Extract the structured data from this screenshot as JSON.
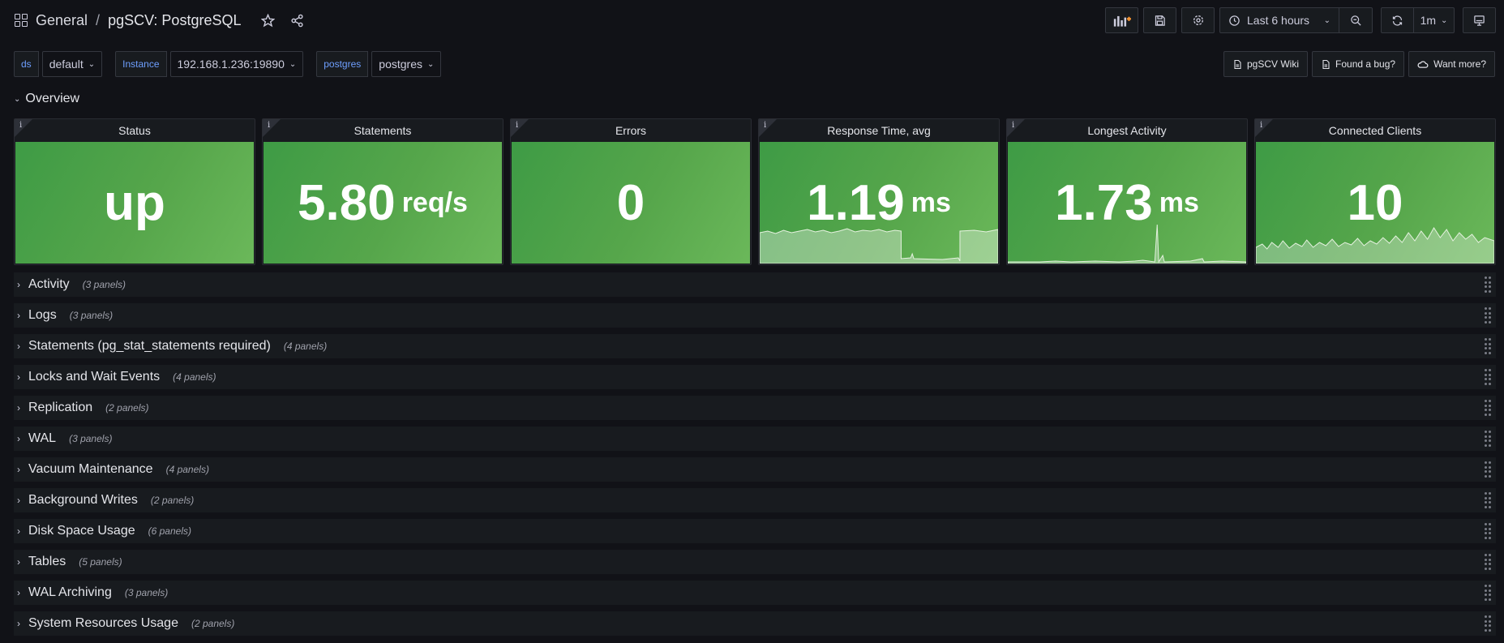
{
  "nav": {
    "breadcrumb_root": "General",
    "separator": "/",
    "dashboard_title": "pgSCV: PostgreSQL",
    "time_range": "Last 6 hours",
    "refresh_interval": "1m"
  },
  "variables": [
    {
      "label": "ds",
      "value": "default"
    },
    {
      "label": "Instance",
      "value": "192.168.1.236:19890"
    },
    {
      "label": "postgres",
      "value": "postgres"
    }
  ],
  "links": [
    {
      "label": "pgSCV Wiki",
      "icon": "doc-icon"
    },
    {
      "label": "Found a bug?",
      "icon": "doc-icon"
    },
    {
      "label": "Want more?",
      "icon": "cloud-icon"
    }
  ],
  "overview": {
    "title": "Overview"
  },
  "stats": [
    {
      "title": "Status",
      "value": "up",
      "unit": ""
    },
    {
      "title": "Statements",
      "value": "5.80",
      "unit": "req/s"
    },
    {
      "title": "Errors",
      "value": "0",
      "unit": ""
    },
    {
      "title": "Response Time, avg",
      "value": "1.19",
      "unit": "ms"
    },
    {
      "title": "Longest Activity",
      "value": "1.73",
      "unit": "ms"
    },
    {
      "title": "Connected Clients",
      "value": "10",
      "unit": ""
    }
  ],
  "rows": [
    {
      "title": "Activity",
      "count": "(3 panels)"
    },
    {
      "title": "Logs",
      "count": "(3 panels)"
    },
    {
      "title": "Statements (pg_stat_statements required)",
      "count": "(4 panels)"
    },
    {
      "title": "Locks and Wait Events",
      "count": "(4 panels)"
    },
    {
      "title": "Replication",
      "count": "(2 panels)"
    },
    {
      "title": "WAL",
      "count": "(3 panels)"
    },
    {
      "title": "Vacuum Maintenance",
      "count": "(4 panels)"
    },
    {
      "title": "Background Writes",
      "count": "(2 panels)"
    },
    {
      "title": "Disk Space Usage",
      "count": "(6 panels)"
    },
    {
      "title": "Tables",
      "count": "(5 panels)"
    },
    {
      "title": "WAL Archiving",
      "count": "(3 panels)"
    },
    {
      "title": "System Resources Usage",
      "count": "(2 panels)"
    }
  ],
  "colors": {
    "stat_green": "#56a64b",
    "accent_blue": "#6e9fff",
    "add_panel_orange": "#ff9830"
  }
}
